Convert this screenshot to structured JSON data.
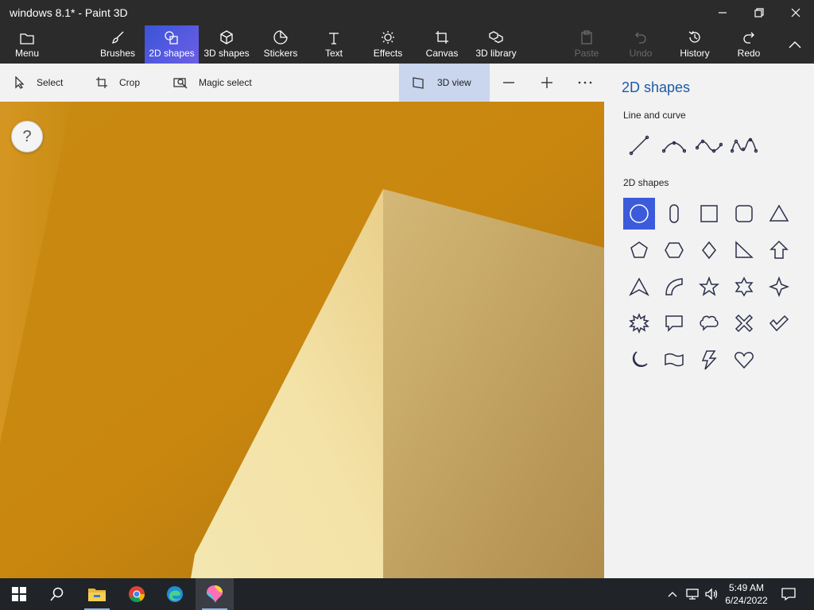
{
  "window": {
    "title": "windows 8.1* - Paint 3D",
    "controls": [
      "minimize-icon",
      "restore-icon",
      "close-icon"
    ]
  },
  "ribbon": {
    "menu": "Menu",
    "brushes": "Brushes",
    "shapes2d": "2D shapes",
    "shapes3d": "3D shapes",
    "stickers": "Stickers",
    "text": "Text",
    "effects": "Effects",
    "canvas": "Canvas",
    "library3d": "3D library",
    "paste": "Paste",
    "undo": "Undo",
    "history": "History",
    "redo": "Redo",
    "active_tab": "2D shapes",
    "accent_color": "#3a54d8"
  },
  "toolbar": {
    "select": "Select",
    "crop": "Crop",
    "magic_select": "Magic select",
    "view3d": "3D view",
    "zoom_out_icon": "minus-icon",
    "zoom_in_icon": "plus-icon",
    "more_icon": "ellipsis-icon"
  },
  "canvas": {
    "help": "?",
    "colors": {
      "background": "#c9870f",
      "light_face": "#f3e2a6",
      "shadow_face": "#b8944f"
    }
  },
  "panel": {
    "title": "2D shapes",
    "line_section": "Line and curve",
    "shapes_section": "2D shapes",
    "line_tools": [
      "line-icon",
      "curve-icon",
      "two-point-curve-icon",
      "three-point-curve-icon"
    ],
    "shapes": [
      "circle-icon",
      "rounded-capsule-icon",
      "square-icon",
      "rounded-square-icon",
      "triangle-icon",
      "pentagon-icon",
      "hexagon-icon",
      "diamond-icon",
      "right-triangle-icon",
      "arrow-up-icon",
      "arrowhead-icon",
      "quarter-circle-icon",
      "star-5-icon",
      "star-6-icon",
      "star-4-icon",
      "burst-icon",
      "speech-bubble-icon",
      "thought-bubble-icon",
      "x-icon",
      "checkmark-icon",
      "crescent-moon-icon",
      "banner-icon",
      "lightning-icon",
      "heart-icon"
    ],
    "selected_shape": "circle-icon"
  },
  "taskbar": {
    "time": "5:49 AM",
    "date": "6/24/2022",
    "apps": [
      "start-icon",
      "search-icon",
      "file-explorer-icon",
      "chrome-icon",
      "edge-icon",
      "paint3d-icon"
    ],
    "tray": [
      "chevron-up-icon",
      "network-icon",
      "volume-icon",
      "notification-icon"
    ]
  }
}
